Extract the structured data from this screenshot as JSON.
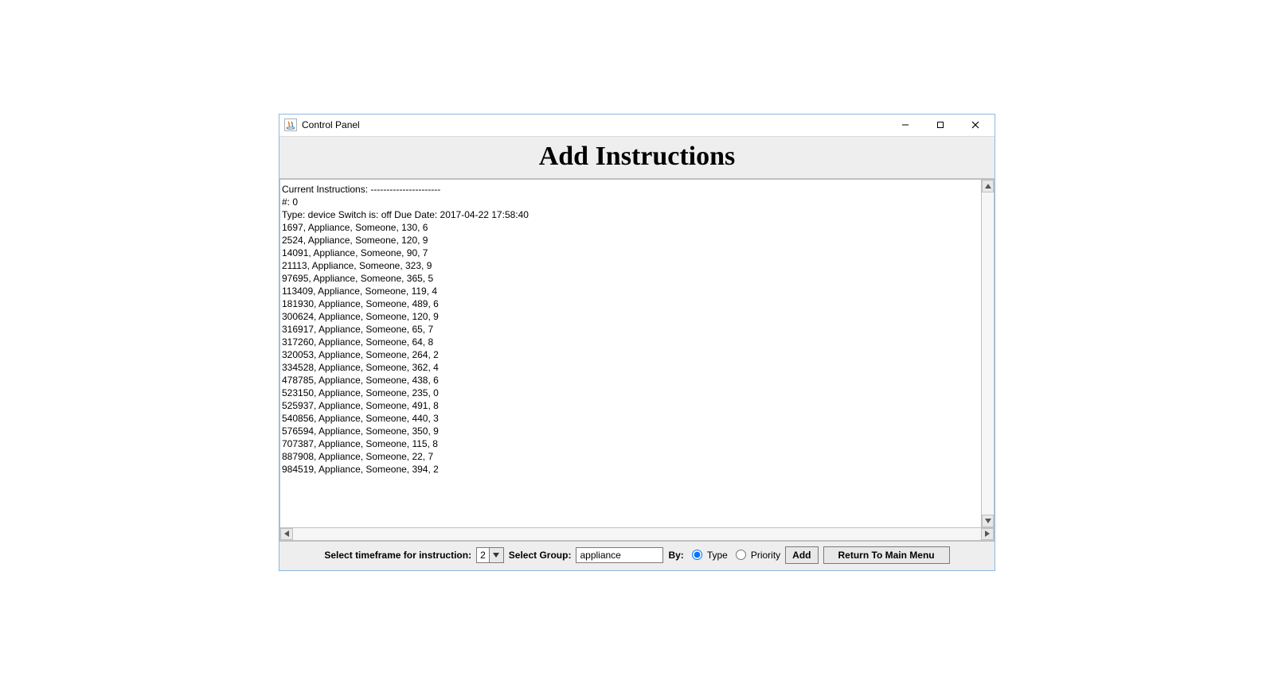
{
  "window": {
    "title": "Control Panel"
  },
  "header": {
    "title": "Add Instructions"
  },
  "textarea": {
    "lines": [
      "Current Instructions: ----------------------",
      "#: 0",
      "Type: device Switch is: off Due Date: 2017-04-22 17:58:40",
      "1697, Appliance, Someone, 130, 6",
      "2524, Appliance, Someone, 120, 9",
      "14091, Appliance, Someone, 90, 7",
      "21113, Appliance, Someone, 323, 9",
      "97695, Appliance, Someone, 365, 5",
      "113409, Appliance, Someone, 119, 4",
      "181930, Appliance, Someone, 489, 6",
      "300624, Appliance, Someone, 120, 9",
      "316917, Appliance, Someone, 65, 7",
      "317260, Appliance, Someone, 64, 8",
      "320053, Appliance, Someone, 264, 2",
      "334528, Appliance, Someone, 362, 4",
      "478785, Appliance, Someone, 438, 6",
      "523150, Appliance, Someone, 235, 0",
      "525937, Appliance, Someone, 491, 8",
      "540856, Appliance, Someone, 440, 3",
      "576594, Appliance, Someone, 350, 9",
      "707387, Appliance, Someone, 115, 8",
      "887908, Appliance, Someone, 22, 7",
      "984519, Appliance, Someone, 394, 2"
    ]
  },
  "footer": {
    "timeframe_label": "Select timeframe for instruction:",
    "timeframe_value": "2",
    "group_label": "Select Group:",
    "group_value": "appliance",
    "by_label": "By:",
    "radio_type": "Type",
    "radio_priority": "Priority",
    "add_button": "Add",
    "return_button": "Return To Main Menu"
  }
}
